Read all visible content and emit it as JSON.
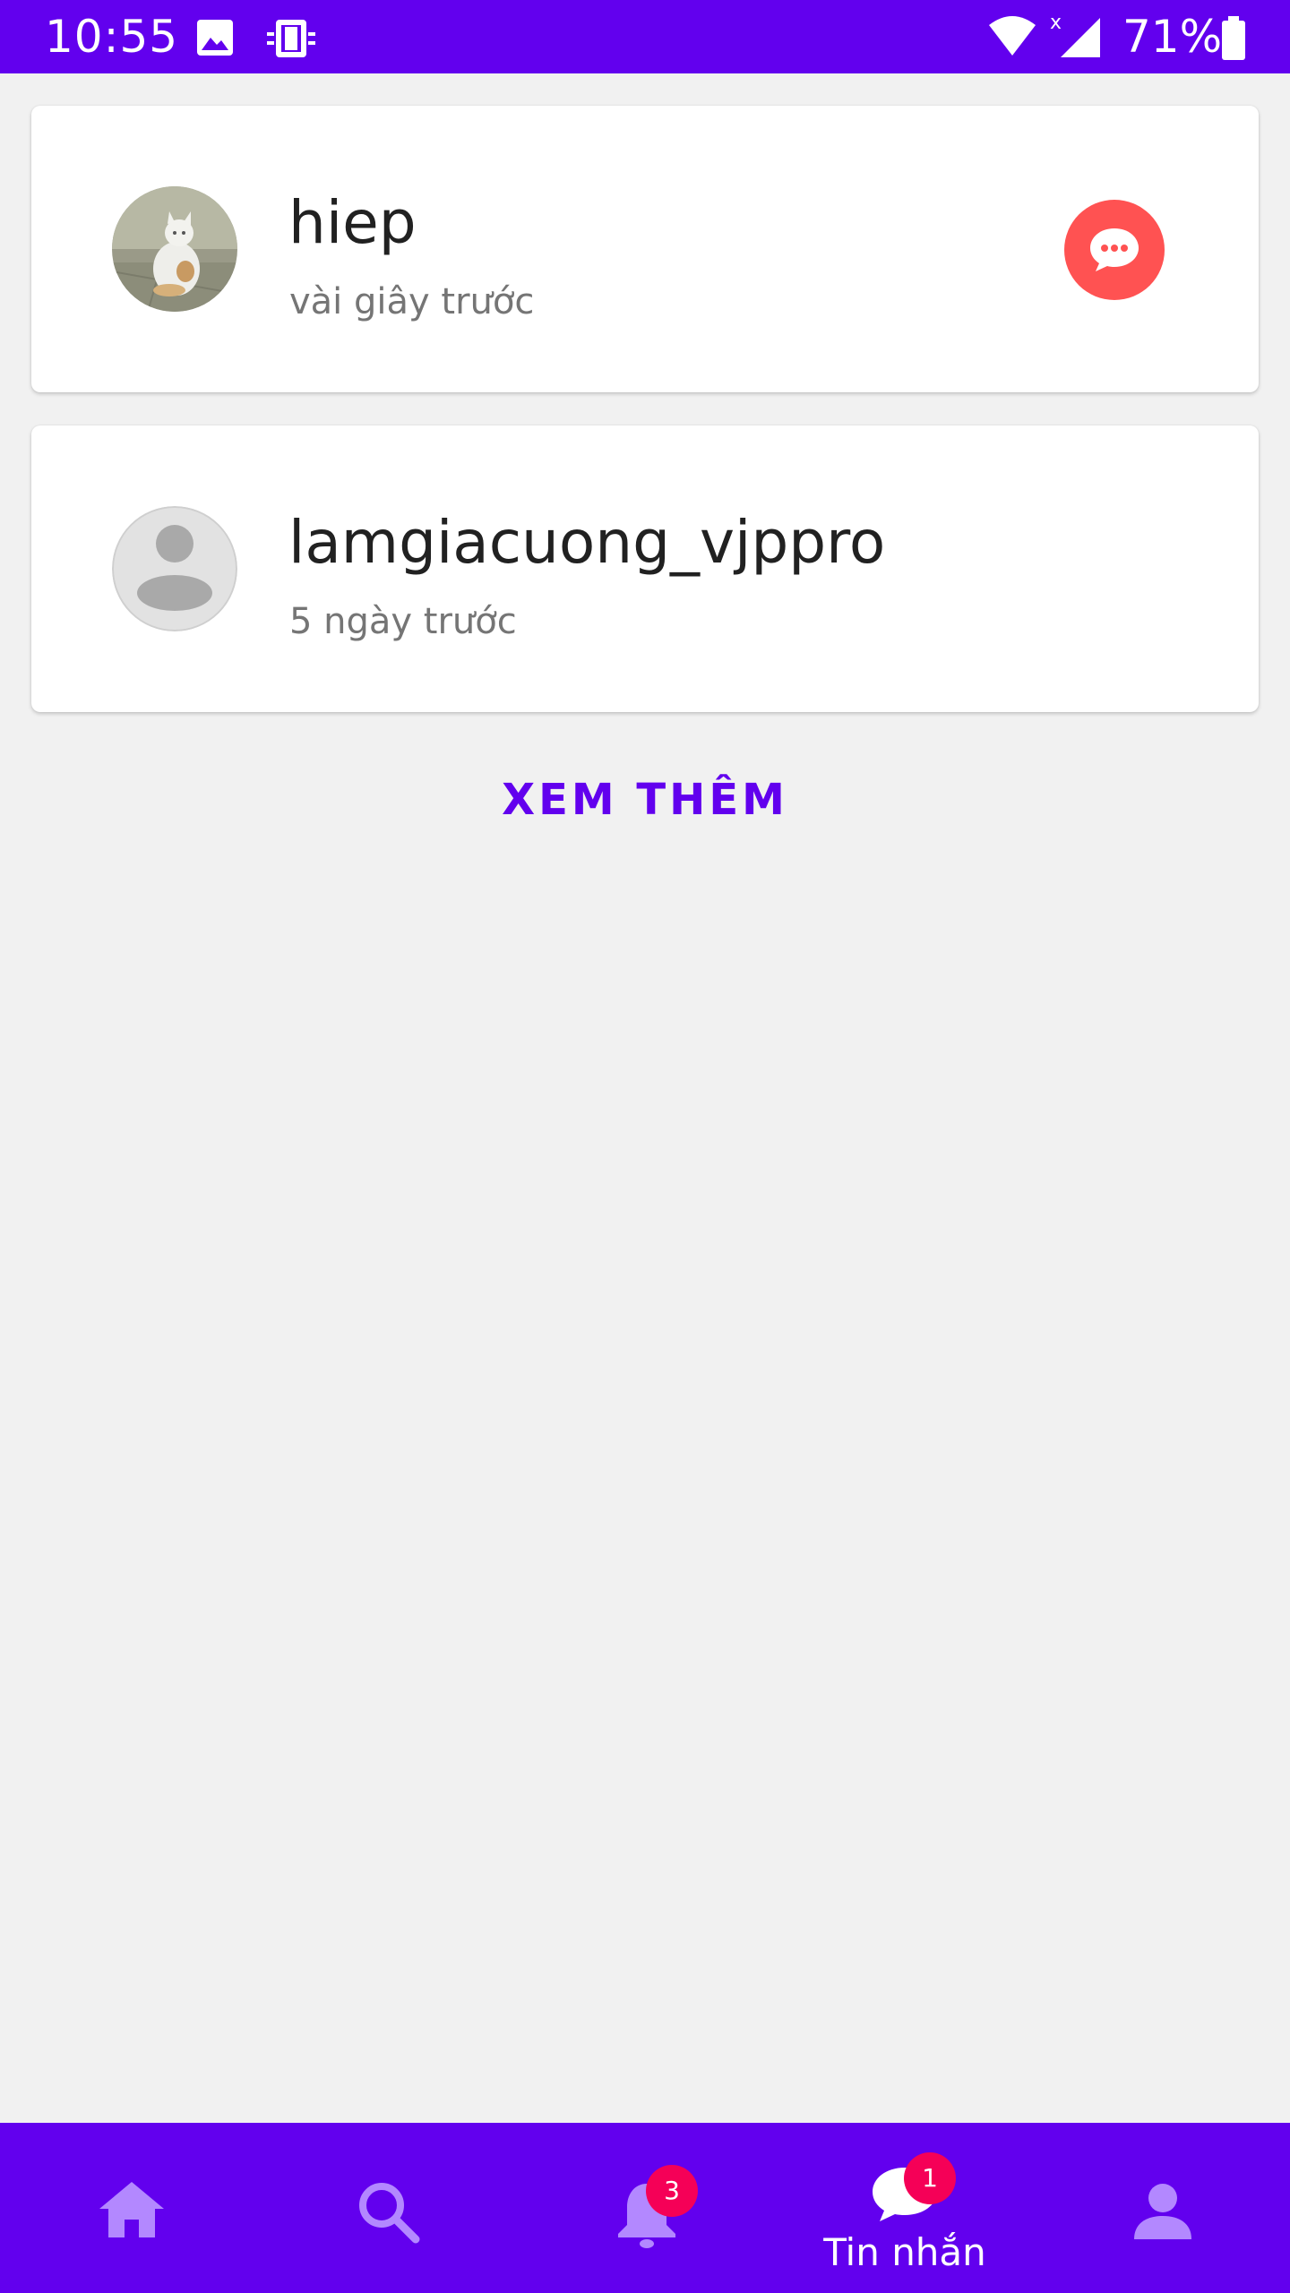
{
  "status_bar": {
    "time": "10:55",
    "battery": "71%",
    "icons": [
      "image-icon",
      "device-mirror-icon",
      "wifi-icon",
      "signal-icon",
      "battery-icon"
    ]
  },
  "conversations": [
    {
      "name": "hiep",
      "time": "vài giây trước",
      "avatar": "cat-photo",
      "has_new_message": true
    },
    {
      "name": "lamgiacuong_vjppro",
      "time": "5 ngày trước",
      "avatar": "default-user-avatar",
      "has_new_message": false
    }
  ],
  "see_more_label": "XEM THÊM",
  "bottom_nav": {
    "items": [
      {
        "icon": "home-icon",
        "label": "",
        "active": false
      },
      {
        "icon": "search-icon",
        "label": "",
        "active": false
      },
      {
        "icon": "bell-icon",
        "label": "",
        "active": false,
        "badge": "3"
      },
      {
        "icon": "chat-icon",
        "label": "Tin nhắn",
        "active": true,
        "badge": "1"
      },
      {
        "icon": "person-icon",
        "label": "",
        "active": false
      }
    ]
  },
  "colors": {
    "primary": "#6200ee",
    "inactive_icon": "#b388ff",
    "badge": "#f50057",
    "chat_indicator": "#ff5252",
    "background": "#f1f1f1"
  }
}
